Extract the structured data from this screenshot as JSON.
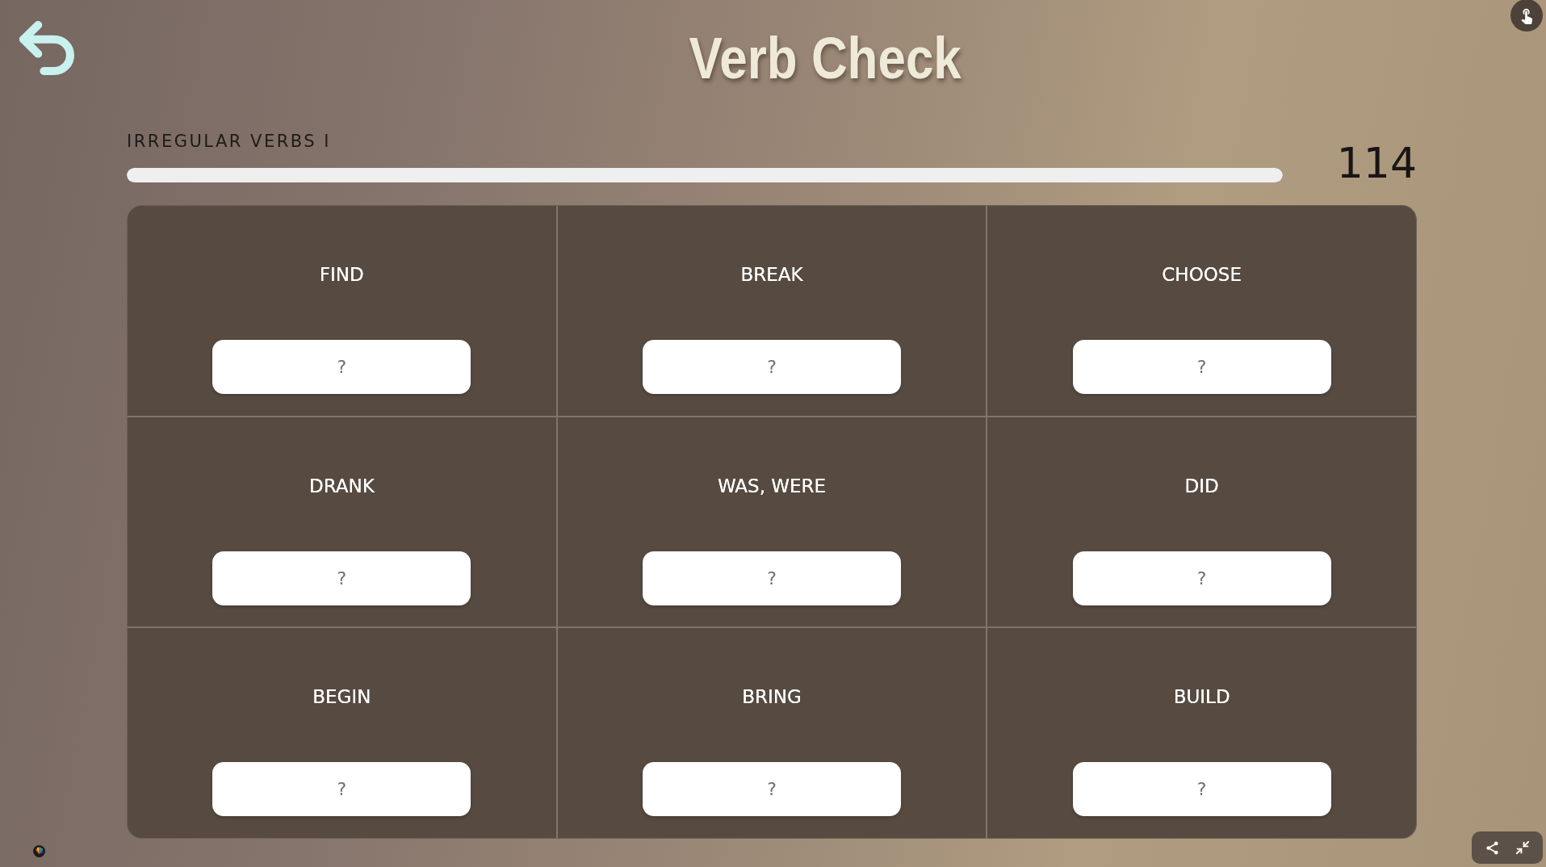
{
  "title": "Verb Check",
  "quiz": {
    "topic": "IRREGULAR VERBS I",
    "progress": {
      "level": 1
    },
    "score": "114"
  },
  "cards": [
    {
      "prompt": "FIND",
      "answer": {
        "placeholder": "?"
      }
    },
    {
      "prompt": "BREAK",
      "answer": {
        "placeholder": "?"
      }
    },
    {
      "prompt": "CHOOSE",
      "answer": {
        "placeholder": "?"
      }
    },
    {
      "prompt": "DRANK",
      "answer": {
        "placeholder": "?"
      }
    },
    {
      "prompt": "WAS, WERE",
      "answer": {
        "placeholder": "?"
      }
    },
    {
      "prompt": "DID",
      "answer": {
        "placeholder": "?"
      }
    },
    {
      "prompt": "BEGIN",
      "answer": {
        "placeholder": "?"
      }
    },
    {
      "prompt": "BRING",
      "answer": {
        "placeholder": "?"
      }
    },
    {
      "prompt": "BUILD",
      "answer": {
        "placeholder": "?"
      }
    }
  ]
}
